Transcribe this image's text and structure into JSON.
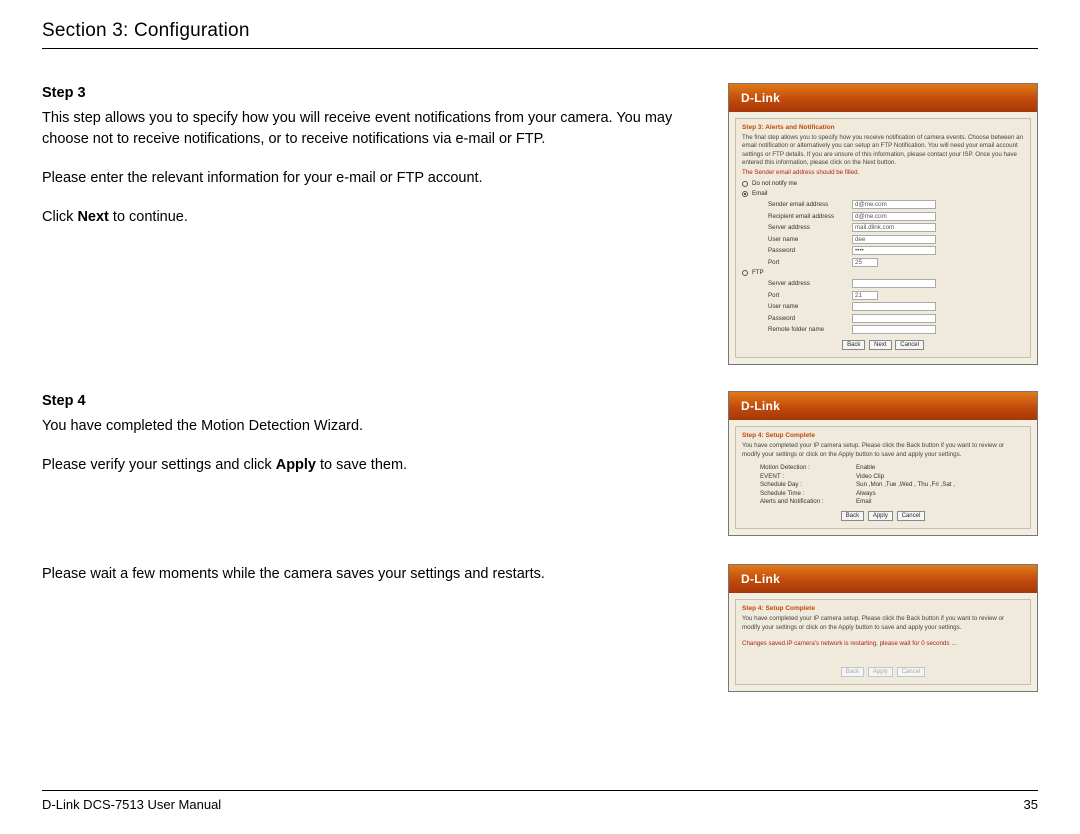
{
  "header": {
    "section_title": "Section 3: Configuration"
  },
  "brand": "D-Link",
  "step3": {
    "label": "Step 3",
    "p1": "This step allows you to specify how you will receive event notifications from your camera. You may choose not to receive notifications, or to receive notifications via e-mail or FTP.",
    "p2": "Please enter the relevant information for your e-mail or FTP account.",
    "p3_pre": "Click ",
    "p3_bold": "Next",
    "p3_post": " to continue.",
    "shot": {
      "title": "Step 3: Alerts and Notification",
      "intro": "The final step allows you to specify how you receive notification of camera events. Choose between an email notification or alternatively you can setup an FTP Notification. You will need your email account settings or FTP details. If you are unsure of this information, please contact your ISP. Once you have entered this information, please click on the Next button.",
      "warn": "The Sender email address should be filled.",
      "opt_none": "Do not notify me",
      "opt_email": "Email",
      "opt_ftp": "FTP",
      "email_fields": {
        "sender": {
          "lbl": "Sender email address",
          "val": "d@me.com"
        },
        "recipient": {
          "lbl": "Recipient email address",
          "val": "d@me.com"
        },
        "server": {
          "lbl": "Server address",
          "val": "mail.dlink.com"
        },
        "user": {
          "lbl": "User name",
          "val": "dee"
        },
        "password": {
          "lbl": "Password",
          "val": "••••"
        },
        "port": {
          "lbl": "Port",
          "val": "25"
        }
      },
      "ftp_fields": {
        "server": {
          "lbl": "Server address",
          "val": ""
        },
        "port": {
          "lbl": "Port",
          "val": "21"
        },
        "user": {
          "lbl": "User name",
          "val": ""
        },
        "password": {
          "lbl": "Password",
          "val": ""
        },
        "folder": {
          "lbl": "Remote folder name",
          "val": ""
        }
      },
      "btn_back": "Back",
      "btn_next": "Next",
      "btn_cancel": "Cancel"
    }
  },
  "step4": {
    "label": "Step 4",
    "p1": "You have completed the Motion Detection Wizard.",
    "p2_pre": "Please verify your settings and click ",
    "p2_bold": "Apply",
    "p2_post": " to save them.",
    "shot": {
      "title": "Step 4: Setup Complete",
      "intro": "You have completed your IP camera setup. Please click the Back button if you want to review or modify your settings or click on the Apply button to save and apply your settings.",
      "kv": [
        {
          "k": "Motion Detection :",
          "v": "Enable"
        },
        {
          "k": "EVENT :",
          "v": "Video Clip"
        },
        {
          "k": "Schedule Day :",
          "v": "Sun ,Mon ,Tue ,Wed , Thu ,Fri ,Sat ,"
        },
        {
          "k": "Schedule Time :",
          "v": "Always"
        },
        {
          "k": "Alerts and Notification :",
          "v": "Email"
        }
      ],
      "btn_back": "Back",
      "btn_apply": "Apply",
      "btn_cancel": "Cancel"
    }
  },
  "restart": {
    "p1": "Please wait a few moments while the camera saves your settings and restarts.",
    "shot": {
      "title": "Step 4: Setup Complete",
      "intro": "You have completed your IP camera setup. Please click the Back button if you want to review or modify your settings or click on the Apply button to save and apply your settings.",
      "msg": "Changes saved.IP camera's network is restarting, please wait for 0 seconds …",
      "btn_back": "Back",
      "btn_apply": "Apply",
      "btn_cancel": "Cancel"
    }
  },
  "footer": {
    "left": "D-Link DCS-7513 User Manual",
    "right": "35"
  }
}
